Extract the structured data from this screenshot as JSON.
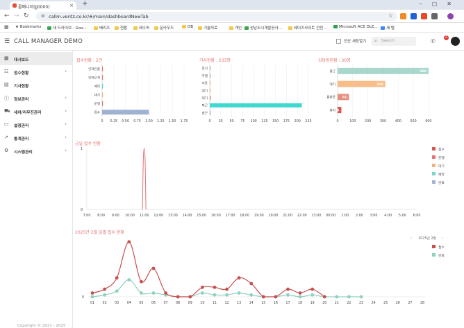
{
  "browser": {
    "tab_title": "콜매니저(JJ0000)",
    "url": "callm.veritz.co.kr/#/main/dashboardNewTab",
    "bookmarks": [
      "Bookmarks",
      "새 드라이브 - Goo...",
      "베리즈",
      "현황",
      "레수퍼",
      "문라우드",
      "DB",
      "기술자료",
      "개인",
      "성남도시개발공사...",
      "헤이즈사이트 전전...",
      "Microsoft ACE OLE...",
      "새 탭"
    ]
  },
  "header": {
    "title": "CALL MANAGER DEMO",
    "popup_label": "전산 새창열기",
    "search_placeholder": "Search",
    "notification_count": "2"
  },
  "sidebar": {
    "items": [
      {
        "label": "대시보드",
        "icon": "grid-icon",
        "chevron": false
      },
      {
        "label": "접수현황",
        "icon": "list-icon",
        "chevron": true
      },
      {
        "label": "기사현황",
        "icon": "doc-icon",
        "chevron": false
      },
      {
        "label": "정보관리",
        "icon": "info-icon",
        "chevron": true
      },
      {
        "label": "세차/리무진관리",
        "icon": "car-icon",
        "chevron": true
      },
      {
        "label": "설정관리",
        "icon": "settings-icon",
        "chevron": true
      },
      {
        "label": "통계관리",
        "icon": "chart-icon",
        "chevron": true
      },
      {
        "label": "시스템관리",
        "icon": "gear-icon",
        "chevron": true
      }
    ]
  },
  "copyright": "Copyright © 2021 - 2025",
  "chart_data": [
    {
      "type": "bar",
      "title": "접수현황 : 2건",
      "orientation": "horizontal",
      "categories": [
        "인라인출",
        "인라오처",
        "예약",
        "대기",
        "운행",
        "접수"
      ],
      "values": [
        0,
        0,
        0,
        0,
        0,
        1
      ],
      "colors": [
        "#e57373",
        "#e57373",
        "#4dd0e1",
        "#f4b183",
        "#e57373",
        "#9fb3d1"
      ],
      "xticks": [
        "0",
        "0.25",
        "0.50",
        "0.75",
        "1.00",
        "1.25",
        "1.50",
        "1.75"
      ],
      "xlim": [
        0,
        1.75
      ]
    },
    {
      "type": "bar",
      "title": "기사현황 : 233명",
      "orientation": "horizontal",
      "categories": [
        "휴식",
        "주행",
        "이동",
        "대기",
        "대기",
        "퇴근",
        "출근"
      ],
      "values": [
        0,
        0,
        0,
        0,
        0,
        210,
        0
      ],
      "colors": [
        "#9fb3d1",
        "#9fb3d1",
        "#f4b183",
        "#f4b183",
        "#e57373",
        "#3fd9d2",
        "#9fb3d1"
      ],
      "xticks": [
        "0",
        "25",
        "50",
        "75",
        "100",
        "125",
        "150",
        "175",
        "200",
        "225"
      ],
      "xlim": [
        0,
        225
      ]
    },
    {
      "type": "bar",
      "title": "상담원현황 : 30명",
      "orientation": "horizontal",
      "categories": [
        "출근",
        "대기",
        "통화중",
        "휴식"
      ],
      "values": [
        600,
        315,
        75,
        25
      ],
      "data_labels": [
        "600",
        "315",
        "61",
        "25"
      ],
      "colors": [
        "#a8d8cc",
        "#f7be8a",
        "#e5907f",
        "#d9534f"
      ],
      "xticks": [
        "0",
        "100",
        "200",
        "300",
        "400",
        "500",
        "600"
      ],
      "xlim": [
        0,
        660
      ]
    },
    {
      "type": "line",
      "title": "금일 접수 현황",
      "x": [
        "7:00",
        "8:00",
        "9:00",
        "10:00",
        "11:00",
        "12:00",
        "13:00",
        "14:00",
        "15:00",
        "16:00",
        "17:00",
        "18:00",
        "19:00",
        "20:00",
        "21:00",
        "22:00",
        "23:00",
        "00:00",
        "1:00",
        "2:00",
        "3:00",
        "4:00",
        "5:00",
        "6:00"
      ],
      "ylim": [
        0,
        1
      ],
      "yticks": [
        "0",
        "1"
      ],
      "series": [
        {
          "name": "접수",
          "color": "#e57373",
          "values": [
            0,
            0,
            0,
            0,
            1,
            0,
            0,
            0,
            0,
            0,
            0,
            0,
            0,
            0,
            0,
            0,
            0,
            0,
            0,
            0,
            0,
            0,
            0,
            0
          ]
        }
      ],
      "legend": [
        {
          "name": "접수",
          "color": "#d9534f"
        },
        {
          "name": "운행",
          "color": "#e57373"
        },
        {
          "name": "대기",
          "color": "#f4b183"
        },
        {
          "name": "예약",
          "color": "#76d7c4"
        },
        {
          "name": "완료",
          "color": "#9fb3d1"
        }
      ],
      "legend_position": "right"
    },
    {
      "type": "line",
      "title": "2025년 2월 일별 접수 현황",
      "month_label": "2025년 2월",
      "x": [
        "01",
        "02",
        "03",
        "04",
        "05",
        "06",
        "07",
        "08",
        "09",
        "10",
        "11",
        "12",
        "13",
        "14",
        "15",
        "16",
        "17",
        "18",
        "19",
        "20",
        "21",
        "22",
        "23",
        "24",
        "25",
        "26",
        "27",
        "28"
      ],
      "yticks": [
        "0"
      ],
      "series": [
        {
          "name": "접수",
          "color": "#c94f4f",
          "values": [
            2,
            4,
            10,
            29,
            8,
            15,
            2,
            0,
            0,
            5,
            5,
            4,
            10,
            7,
            0,
            0,
            4,
            2,
            4,
            0,
            null,
            null,
            null,
            null,
            null,
            null,
            null,
            null
          ]
        },
        {
          "name": "완료",
          "color": "#8fd1c1",
          "values": [
            0,
            1,
            3,
            9,
            2,
            2,
            1,
            0,
            0,
            2,
            1,
            1,
            2,
            1,
            0,
            0,
            1,
            0,
            1,
            0,
            0,
            0,
            0,
            null,
            null,
            null,
            null,
            null
          ]
        }
      ],
      "ymax": 30,
      "legend_position": "right"
    }
  ]
}
